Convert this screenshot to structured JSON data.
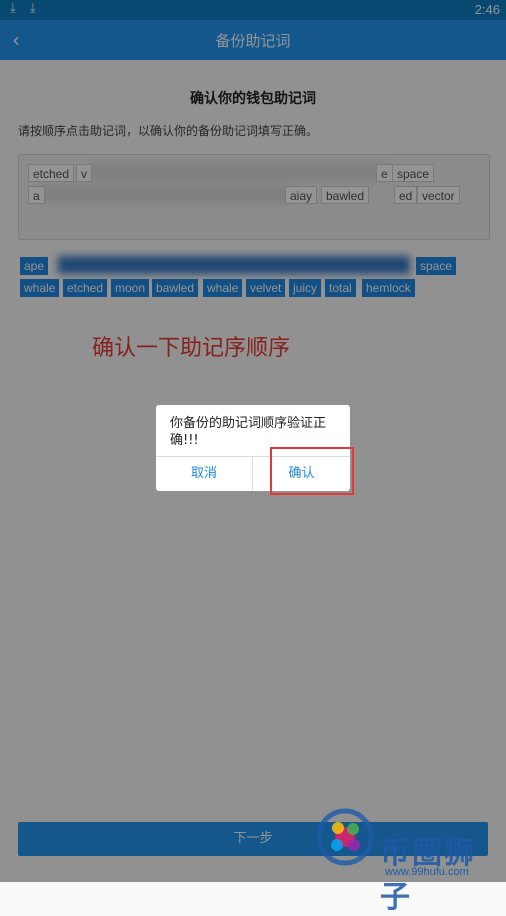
{
  "status_bar": {
    "time": "2:46",
    "icons": [
      "download-icon",
      "download-icon"
    ]
  },
  "app_bar": {
    "title": "备份助记词",
    "back_icon": "back-arrow-icon"
  },
  "heading": "确认你的钱包助记词",
  "instruction": "请按顺序点击助记词，以确认你的备份助记词填写正确。",
  "selected_words": {
    "row1": [
      "etched",
      "v",
      "e",
      "space"
    ],
    "row2": [
      "a",
      "aiay",
      "bawled",
      "ed",
      "vector"
    ]
  },
  "word_choices": {
    "row1": [
      "ape",
      "space"
    ],
    "row2": [
      "whale",
      "etched",
      "moon",
      "bawled",
      "whale",
      "velvet",
      "juicy",
      "total",
      "hemlock"
    ]
  },
  "annotation": "确认一下助记序顺序",
  "next_button": "下一步",
  "dialog": {
    "message": "你备份的助记词顺序验证正确!!!",
    "cancel": "取消",
    "confirm": "确认"
  },
  "watermark": {
    "text": "币圈狮子",
    "url": "www.99hufu.com"
  },
  "colors": {
    "primary": "#2196f3",
    "status_bar": "#0d7fc2",
    "annotation": "#e53935",
    "chip_selected": "#1e88e5"
  }
}
